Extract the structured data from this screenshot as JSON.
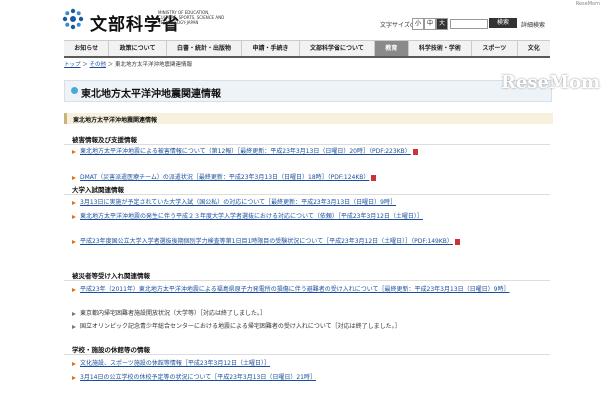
{
  "header": {
    "logo_text": "文部科学省",
    "logo_en": "MINISTRY OF EDUCATION, CULTURE, SPORTS, SCIENCE AND TECHNOLOGY-JAPAN",
    "fontsize_label": "文字サイズの変更",
    "fontsize_small": "小",
    "fontsize_medium": "中",
    "fontsize_large": "大",
    "search_button": "検索",
    "advanced_search": "詳細検索",
    "corner_tag": "ReseMom"
  },
  "nav": {
    "items": [
      "お知らせ",
      "政策について",
      "白書・統計・出版物",
      "申請・手続き",
      "文部科学省について",
      "教育",
      "科学技術・学術",
      "スポーツ",
      "文化"
    ],
    "active_index": 5
  },
  "breadcrumb": {
    "home": "トップ",
    "mid": "その他",
    "current": "東北地方太平洋沖地震関連情報"
  },
  "page": {
    "title": "東北地方太平洋沖地震関連情報",
    "section": "東北地方太平洋沖地震関連情報",
    "watermark": "ReseMom"
  },
  "sections": [
    {
      "heading": "被害情報及び支援情報",
      "items": [
        {
          "text": "東北地方太平洋沖地震による被害情報について（第12報）［最終更新：平成23年3月13日（日曜日）20時］（PDF:223KB）",
          "link": true,
          "pdf": true
        },
        {
          "text": "DMAT（災害派遣医療チーム）の派遣状況［最終更新：平成23年3月13日（日曜日）18時］（PDF:124KB）",
          "link": true,
          "pdf": true
        }
      ]
    },
    {
      "heading": "大学入試関連情報",
      "items": [
        {
          "text": "3月13日に実施が予定されていた大学入試（国公私）の対応について［最終更新：平成23年3月13日（日曜日）9時］",
          "link": true,
          "pdf": false
        },
        {
          "text": "東北地方太平洋沖地震の発生に伴う平成２３年度大学入学者選抜における対応について（依頼）［平成23年3月12日（土曜日）］",
          "link": true,
          "pdf": false
        },
        {
          "text": "平成23年度国公立大学入学者選抜後期個別学力検査等第1日目1時限目の受験状況について［平成23年3月12日（土曜日）］（PDF:149KB）",
          "link": true,
          "pdf": true
        }
      ]
    },
    {
      "heading": "被災者等受け入れ関連情報",
      "items": [
        {
          "text": "平成23年（2011年）東北地方太平洋沖地震による福島県原子力発電所の損傷に伴う避難者の受け入れについて［最終更新：平成23年3月13日（日曜日）9時］",
          "link": true,
          "pdf": false
        },
        {
          "text": "東京都内帰宅困難者施設開放状況（大学等）［対応は終了しました。］",
          "link": false,
          "pdf": false
        },
        {
          "text": "国立オリンピック記念青少年総合センターにおける地震による帰宅困難者の受け入れについて［対応は終了しました。］",
          "link": false,
          "pdf": false
        }
      ]
    },
    {
      "heading": "学校・施設の休館等の情報",
      "items": [
        {
          "text": "文化施設、スポーツ施設の休館等情報［平成23年3月12日（土曜日）］",
          "link": true,
          "pdf": false
        },
        {
          "text": "3月14日の公立学校の休校予定等の状況について［平成23年3月13日（日曜日）21時］",
          "link": true,
          "pdf": false
        }
      ]
    }
  ]
}
